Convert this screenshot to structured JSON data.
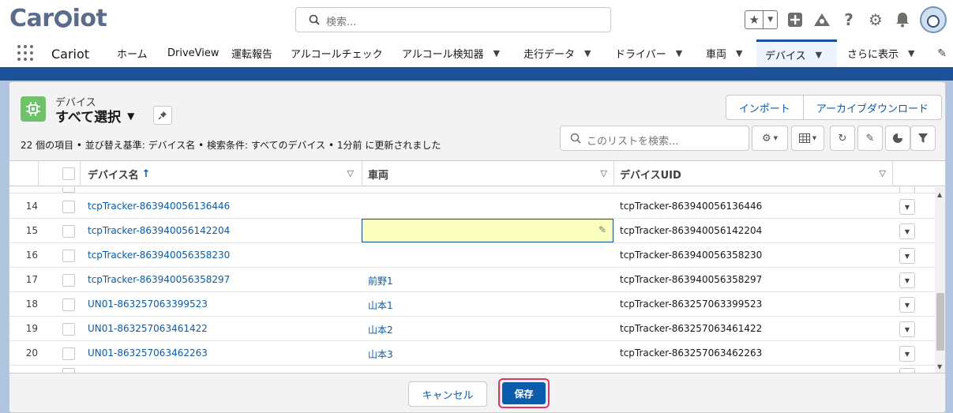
{
  "header": {
    "logo": "Cariot",
    "search_placeholder": "検索..."
  },
  "nav": {
    "app_name": "Cariot",
    "tabs": [
      {
        "label": "ホーム",
        "chevron": false,
        "active": false
      },
      {
        "label": "DriveView",
        "chevron": false,
        "active": false
      },
      {
        "label": "運転報告",
        "chevron": false,
        "active": false
      },
      {
        "label": "アルコールチェック",
        "chevron": false,
        "active": false
      },
      {
        "label": "アルコール検知器",
        "chevron": true,
        "active": false
      },
      {
        "label": "走行データ",
        "chevron": true,
        "active": false
      },
      {
        "label": "ドライバー",
        "chevron": true,
        "active": false
      },
      {
        "label": "車両",
        "chevron": true,
        "active": false
      },
      {
        "label": "デバイス",
        "chevron": true,
        "active": true
      },
      {
        "label": "さらに表示",
        "chevron": true,
        "active": false
      }
    ]
  },
  "list_view": {
    "object_label": "デバイス",
    "title": "すべて選択",
    "buttons": {
      "import": "インポート",
      "archive": "アーカイブダウンロード"
    },
    "meta": "22 個の項目 • 並び替え基準: デバイス名 • 検索条件: すべてのデバイス • 1分前 に更新されました",
    "search_placeholder": "このリストを検索...",
    "columns": {
      "name": "デバイス名",
      "sort_indicator": "↑",
      "vehicle": "車両",
      "uid": "デバイスUID"
    },
    "rows": [
      {
        "num": "14",
        "name": "tcpTracker-863940056136446",
        "vehicle": "",
        "uid": "tcpTracker-863940056136446"
      },
      {
        "num": "15",
        "name": "tcpTracker-863940056142204",
        "vehicle": "",
        "uid": "tcpTracker-863940056142204",
        "editing": true
      },
      {
        "num": "16",
        "name": "tcpTracker-863940056358230",
        "vehicle": "",
        "uid": "tcpTracker-863940056358230"
      },
      {
        "num": "17",
        "name": "tcpTracker-863940056358297",
        "vehicle": "前野1",
        "uid": "tcpTracker-863940056358297"
      },
      {
        "num": "18",
        "name": "UN01-863257063399523",
        "vehicle": "山本1",
        "uid": "tcpTracker-863257063399523"
      },
      {
        "num": "19",
        "name": "UN01-863257063461422",
        "vehicle": "山本2",
        "uid": "tcpTracker-863257063461422"
      },
      {
        "num": "20",
        "name": "UN01-863257063462263",
        "vehicle": "山本3",
        "uid": "tcpTracker-863257063462263"
      }
    ]
  },
  "footer": {
    "cancel": "キャンセル",
    "save": "保存"
  },
  "colors": {
    "brand": "#1b5297",
    "link": "#0b5cab",
    "edit_cell": "#faffbd",
    "highlight": "#e4335d",
    "object_icon": "#6fc16a"
  }
}
